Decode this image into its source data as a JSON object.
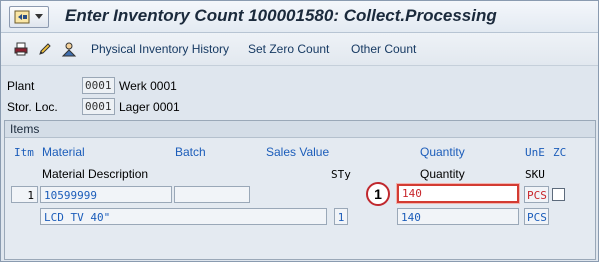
{
  "window": {
    "title": "Enter Inventory Count 100001580: Collect.Processing"
  },
  "toolbar": {
    "links": [
      "Physical Inventory History",
      "Set Zero Count",
      "Other Count"
    ]
  },
  "header": {
    "plant_label": "Plant",
    "plant_code": "0001",
    "plant_name": "Werk 0001",
    "sloc_label": "Stor. Loc.",
    "sloc_code": "0001",
    "sloc_name": "Lager 0001"
  },
  "items": {
    "group_title": "Items",
    "columns_row1": {
      "itm": "Itm",
      "material": "Material",
      "batch": "Batch",
      "sales_value": "Sales Value",
      "quantity": "Quantity",
      "une": "UnE",
      "zc": "ZC"
    },
    "columns_row2": {
      "material_description": "Material Description",
      "sty": "STy",
      "quantity": "Quantity",
      "sku": "SKU"
    },
    "rows": [
      {
        "itm": "1",
        "material": "10599999",
        "batch": "",
        "sales_value": "",
        "quantity": "140",
        "une": "PCS",
        "zero_count": false,
        "description": "LCD TV 40\"",
        "sty": "1",
        "sku_quantity": "140",
        "sku": "PCS"
      }
    ]
  },
  "annotation": {
    "marker": "1"
  },
  "colors": {
    "highlight_border": "#d33b32",
    "blue_text": "#1c5dba",
    "red_text": "#c8262b"
  }
}
